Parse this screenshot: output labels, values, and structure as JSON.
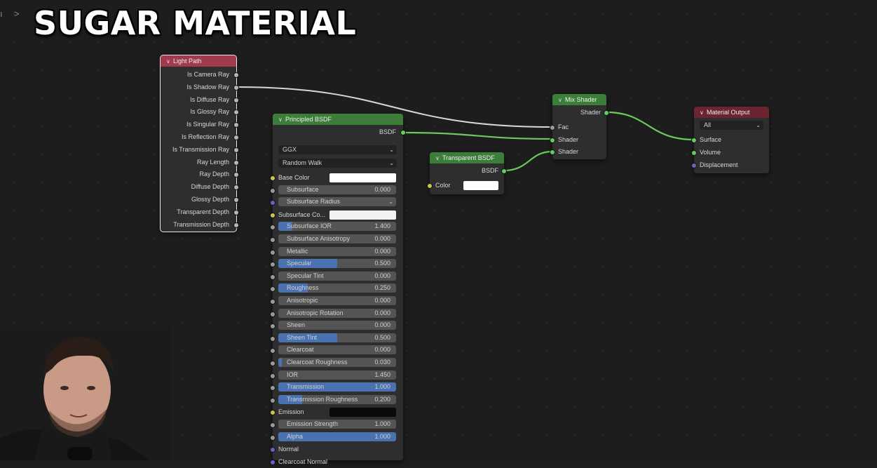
{
  "video_title": "SUGAR MATERIAL",
  "breadcrumb": {
    "chevron": ">",
    "item": "al"
  },
  "colors": {
    "input_header": "#a03a4c",
    "shader_header": "#3d7d3a",
    "output_header": "#6a2530",
    "wire_green": "#6cc95e",
    "wire_white": "#d0d0d0"
  },
  "nodes": {
    "light_path": {
      "title": "Light Path",
      "outputs": [
        "Is Camera Ray",
        "Is Shadow Ray",
        "Is Diffuse Ray",
        "Is Glossy Ray",
        "Is Singular Ray",
        "Is Reflection Ray",
        "Is Transmission Ray",
        "Ray Length",
        "Ray Depth",
        "Diffuse Depth",
        "Glossy Depth",
        "Transparent Depth",
        "Transmission Depth"
      ]
    },
    "principled": {
      "title": "Principled BSDF",
      "output": "BSDF",
      "distribution": "GGX",
      "subsurface_method": "Random Walk",
      "base_color": {
        "label": "Base Color",
        "color": "#ffffff"
      },
      "subsurface_color": {
        "label": "Subsurface Co...",
        "color": "#f2f2f2"
      },
      "subsurface_radius": "Subsurface Radius",
      "emission": {
        "label": "Emission",
        "color": "#0a0a0a"
      },
      "fields": [
        {
          "label": "Subsurface",
          "value": "0.000",
          "fill": 0
        },
        {
          "label": "Subsurface IOR",
          "value": "1.400",
          "fill": 0.12
        },
        {
          "label": "Subsurface Anisotropy",
          "value": "0.000",
          "fill": 0
        },
        {
          "label": "Metallic",
          "value": "0.000",
          "fill": 0
        },
        {
          "label": "Specular",
          "value": "0.500",
          "fill": 0.5
        },
        {
          "label": "Specular Tint",
          "value": "0.000",
          "fill": 0
        },
        {
          "label": "Roughness",
          "value": "0.250",
          "fill": 0.25
        },
        {
          "label": "Anisotropic",
          "value": "0.000",
          "fill": 0
        },
        {
          "label": "Anisotropic Rotation",
          "value": "0.000",
          "fill": 0
        },
        {
          "label": "Sheen",
          "value": "0.000",
          "fill": 0
        },
        {
          "label": "Sheen Tint",
          "value": "0.500",
          "fill": 0.5
        },
        {
          "label": "Clearcoat",
          "value": "0.000",
          "fill": 0
        },
        {
          "label": "Clearcoat Roughness",
          "value": "0.030",
          "fill": 0.03
        },
        {
          "label": "IOR",
          "value": "1.450",
          "fill": 0
        },
        {
          "label": "Transmission",
          "value": "1.000",
          "fill": 1
        },
        {
          "label": "Transmission Roughness",
          "value": "0.200",
          "fill": 0.2
        },
        {
          "label": "Emission Strength",
          "value": "1.000",
          "fill": 0
        },
        {
          "label": "Alpha",
          "value": "1.000",
          "fill": 1
        }
      ],
      "normal": "Normal",
      "clearcoat_normal": "Clearcoat Normal"
    },
    "transparent": {
      "title": "Transparent BSDF",
      "output": "BSDF",
      "color_label": "Color",
      "color": "#ffffff"
    },
    "mix": {
      "title": "Mix Shader",
      "output": "Shader",
      "inputs": [
        "Fac",
        "Shader",
        "Shader"
      ]
    },
    "output": {
      "title": "Material Output",
      "target": "All",
      "inputs": [
        "Surface",
        "Volume",
        "Displacement"
      ]
    }
  }
}
